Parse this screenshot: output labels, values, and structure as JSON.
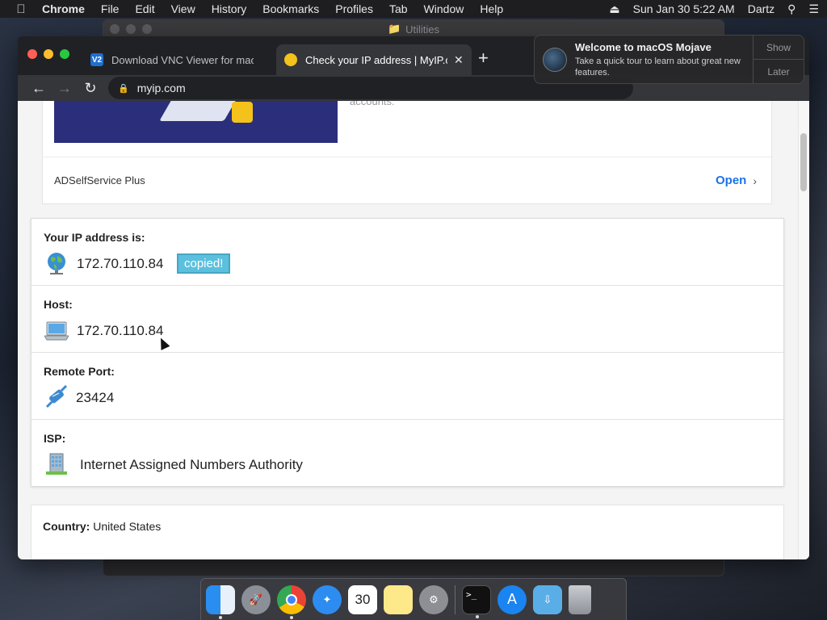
{
  "menubar": {
    "app_name": "Chrome",
    "items": [
      "File",
      "Edit",
      "View",
      "History",
      "Bookmarks",
      "Profiles",
      "Tab",
      "Window",
      "Help"
    ],
    "clock": "Sun Jan 30  5:22 AM",
    "user": "Dartz"
  },
  "background_window": {
    "title": "Utilities"
  },
  "browser": {
    "tabs": [
      {
        "title": "Download VNC Viewer for mac",
        "favicon": "V2",
        "active": false
      },
      {
        "title": "Check your IP address | MyIP.c",
        "favicon": "myip",
        "active": true
      }
    ],
    "url": "myip.com"
  },
  "ad": {
    "text": "accounts.",
    "name": "ADSelfService Plus",
    "open_label": "Open",
    "open_chevron": "›"
  },
  "ip_info": {
    "ip": {
      "label": "Your IP address is:",
      "value": "172.70.110.84",
      "badge": "copied!"
    },
    "host": {
      "label": "Host:",
      "value": "172.70.110.84"
    },
    "port": {
      "label": "Remote Port:",
      "value": "23424"
    },
    "isp": {
      "label": "ISP:",
      "value": "Internet Assigned Numbers Authority"
    }
  },
  "country": {
    "label": "Country:",
    "value": "United States"
  },
  "notification": {
    "title": "Welcome to macOS Mojave",
    "body": "Take a quick tour to learn about great new features.",
    "show_label": "Show",
    "later_label": "Later"
  },
  "dock": {
    "calendar_day": "30",
    "terminal_prompt": ">_",
    "items": [
      "finder-icon",
      "launchpad-icon",
      "chrome-icon",
      "safari-icon",
      "calendar-icon",
      "notes-icon",
      "system-preferences-icon",
      "terminal-icon",
      "app-store-icon",
      "downloads-folder-icon",
      "trash-icon"
    ]
  },
  "colors": {
    "link_blue": "#1a73e8",
    "copied_badge": "#5bc0de",
    "tab_active": "#35363a",
    "chrome_frame": "#202124"
  }
}
